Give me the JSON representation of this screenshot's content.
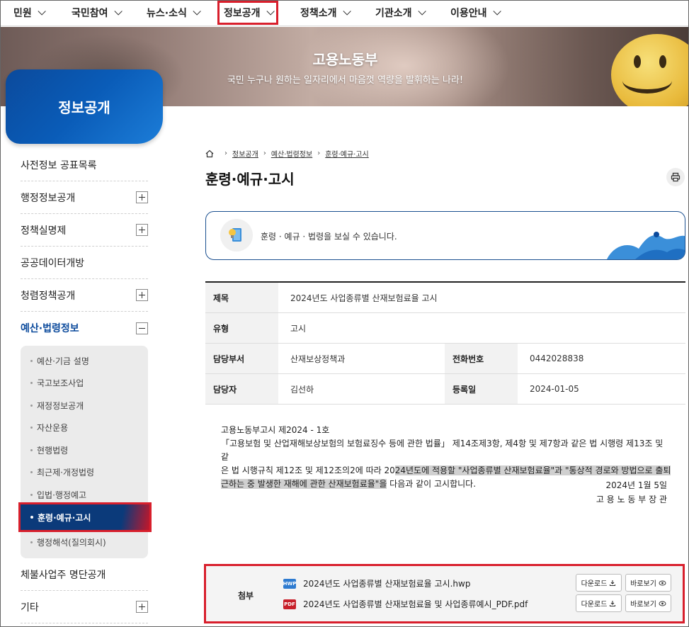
{
  "nav": {
    "items": [
      {
        "label": "민원"
      },
      {
        "label": "국민참여"
      },
      {
        "label": "뉴스·소식"
      },
      {
        "label": "정보공개"
      },
      {
        "label": "정책소개"
      },
      {
        "label": "기관소개"
      },
      {
        "label": "이용안내"
      }
    ]
  },
  "banner": {
    "title": "고용노동부",
    "subtitle": "국민 누구나 원하는 일자리에서 마음껏 역량을 발휘하는 나라!"
  },
  "sidebar": {
    "title": "정보공개",
    "items": [
      {
        "label": "사전정보 공표목록"
      },
      {
        "label": "행정정보공개"
      },
      {
        "label": "정책실명제"
      },
      {
        "label": "공공데이터개방"
      },
      {
        "label": "청렴정책공개"
      },
      {
        "label": "예산·법령정보"
      },
      {
        "label": "체불사업주 명단공개"
      },
      {
        "label": "기타"
      }
    ],
    "sub_items": [
      {
        "label": "예산·기금 설명"
      },
      {
        "label": "국고보조사업"
      },
      {
        "label": "재정정보공개"
      },
      {
        "label": "자산운용"
      },
      {
        "label": "현행법령"
      },
      {
        "label": "최근제·개정법령"
      },
      {
        "label": "입법·행정예고"
      },
      {
        "label": "훈령·예규·고시"
      },
      {
        "label": "행정해석(질의회시)"
      }
    ]
  },
  "breadcrumb": {
    "items": [
      "정보공개",
      "예산·법령정보",
      "훈령·예규·고시"
    ]
  },
  "page": {
    "title": "훈령·예규·고시",
    "info_text": "훈령 · 예규 · 법령을 보실 수 있습니다."
  },
  "detail": {
    "title_label": "제목",
    "title_value": "2024년도 사업종류별 산재보험료율 고시",
    "type_label": "유형",
    "type_value": "고시",
    "dept_label": "담당부서",
    "dept_value": "산재보상정책과",
    "phone_label": "전화번호",
    "phone_value": "0442028838",
    "person_label": "담당자",
    "person_value": "김선하",
    "date_label": "등록일",
    "date_value": "2024-01-05"
  },
  "content": {
    "line1": "고용노동부고시 제2024 - 1호",
    "line2": "「고용보험 및 산업재해보상보험의 보험료징수 등에 관한 법률」 제14조제3항, 제4항 및 제7항과 같은 법 시행령 제13조 및 같",
    "line3a": "은 법 시행규칙 제12조 및 제12조의2에 따라 20",
    "line3b": "24년도에 적용할 \"사업종류별 산재보험료율\"과 \"통상적 경로와 방법으로 출퇴",
    "line4a": "근하는 중 발생한 재해에 관한 산재보험료율\"을",
    "line4b": " 다음과 같이 고시합니다.",
    "date": "2024년 1월 5일",
    "signer": "고 용 노 동 부 장 관"
  },
  "attachments": {
    "label": "첨부",
    "files": [
      {
        "name": "2024년도 사업종류별 산재보험료율 고시.hwp",
        "type": "HWP",
        "download": "다운로드",
        "view": "바로보기"
      },
      {
        "name": "2024년도 사업종류별 산재보험료율 및 사업종류예시_PDF.pdf",
        "type": "PDF",
        "download": "다운로드",
        "view": "바로보기"
      }
    ]
  },
  "colors": {
    "brand_blue": "#0b4a9c",
    "highlight_red": "#d81f2c"
  }
}
